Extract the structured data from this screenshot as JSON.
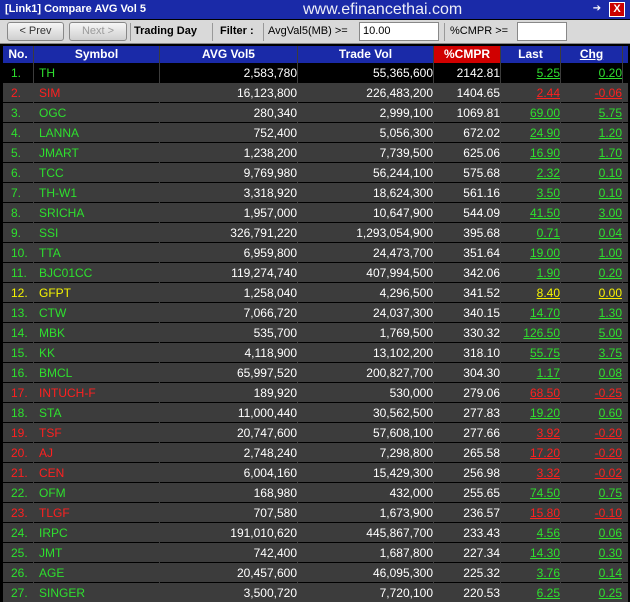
{
  "window": {
    "title": "[Link1] Compare AVG Vol 5",
    "watermark": "www.efinancethai.com",
    "pin_glyph": "➔",
    "close_glyph": "X"
  },
  "toolbar": {
    "prev_label": "< Prev",
    "next_label": "Next >",
    "trading_day_label": "Trading Day",
    "filter_label": "Filter :",
    "avg_filter_label": "AvgVal5(MB) >=",
    "avg_filter_value": "10.00",
    "cmpr_filter_label": "%CMPR >=",
    "cmpr_filter_value": ""
  },
  "columns": {
    "no": "No.",
    "symbol": "Symbol",
    "avg_vol5": "AVG Vol5",
    "trade_vol": "Trade Vol",
    "cmpr": "%CMPR",
    "last": "Last",
    "chg": "Chg"
  },
  "colors": {
    "up": "#2ee02e",
    "down": "#ff2020",
    "unchanged": "#f5f500",
    "header": "#1a2aa8",
    "active_sort": "#d00000"
  },
  "rows": [
    {
      "no": "1.",
      "symbol": "TH",
      "avg": "2,583,780",
      "trade": "55,365,600",
      "cmpr": "2142.81",
      "last": "5.25",
      "chg": "0.20",
      "dir": "up"
    },
    {
      "no": "2.",
      "symbol": "SIM",
      "avg": "16,123,800",
      "trade": "226,483,200",
      "cmpr": "1404.65",
      "last": "2.44",
      "chg": "-0.06",
      "dir": "down"
    },
    {
      "no": "3.",
      "symbol": "OGC",
      "avg": "280,340",
      "trade": "2,999,100",
      "cmpr": "1069.81",
      "last": "69.00",
      "chg": "5.75",
      "dir": "up"
    },
    {
      "no": "4.",
      "symbol": "LANNA",
      "avg": "752,400",
      "trade": "5,056,300",
      "cmpr": "672.02",
      "last": "24.90",
      "chg": "1.20",
      "dir": "up"
    },
    {
      "no": "5.",
      "symbol": "JMART",
      "avg": "1,238,200",
      "trade": "7,739,500",
      "cmpr": "625.06",
      "last": "16.90",
      "chg": "1.70",
      "dir": "up"
    },
    {
      "no": "6.",
      "symbol": "TCC",
      "avg": "9,769,980",
      "trade": "56,244,100",
      "cmpr": "575.68",
      "last": "2.32",
      "chg": "0.10",
      "dir": "up"
    },
    {
      "no": "7.",
      "symbol": "TH-W1",
      "avg": "3,318,920",
      "trade": "18,624,300",
      "cmpr": "561.16",
      "last": "3.50",
      "chg": "0.10",
      "dir": "up"
    },
    {
      "no": "8.",
      "symbol": "SRICHA",
      "avg": "1,957,000",
      "trade": "10,647,900",
      "cmpr": "544.09",
      "last": "41.50",
      "chg": "3.00",
      "dir": "up"
    },
    {
      "no": "9.",
      "symbol": "SSI",
      "avg": "326,791,220",
      "trade": "1,293,054,900",
      "cmpr": "395.68",
      "last": "0.71",
      "chg": "0.04",
      "dir": "up"
    },
    {
      "no": "10.",
      "symbol": "TTA",
      "avg": "6,959,800",
      "trade": "24,473,700",
      "cmpr": "351.64",
      "last": "19.00",
      "chg": "1.00",
      "dir": "up"
    },
    {
      "no": "11.",
      "symbol": "BJC01CC",
      "avg": "119,274,740",
      "trade": "407,994,500",
      "cmpr": "342.06",
      "last": "1.90",
      "chg": "0.20",
      "dir": "up"
    },
    {
      "no": "12.",
      "symbol": "GFPT",
      "avg": "1,258,040",
      "trade": "4,296,500",
      "cmpr": "341.52",
      "last": "8.40",
      "chg": "0.00",
      "dir": "unchanged"
    },
    {
      "no": "13.",
      "symbol": "CTW",
      "avg": "7,066,720",
      "trade": "24,037,300",
      "cmpr": "340.15",
      "last": "14.70",
      "chg": "1.30",
      "dir": "up"
    },
    {
      "no": "14.",
      "symbol": "MBK",
      "avg": "535,700",
      "trade": "1,769,500",
      "cmpr": "330.32",
      "last": "126.50",
      "chg": "5.00",
      "dir": "up"
    },
    {
      "no": "15.",
      "symbol": "KK",
      "avg": "4,118,900",
      "trade": "13,102,200",
      "cmpr": "318.10",
      "last": "55.75",
      "chg": "3.75",
      "dir": "up"
    },
    {
      "no": "16.",
      "symbol": "BMCL",
      "avg": "65,997,520",
      "trade": "200,827,700",
      "cmpr": "304.30",
      "last": "1.17",
      "chg": "0.08",
      "dir": "up"
    },
    {
      "no": "17.",
      "symbol": "INTUCH-F",
      "avg": "189,920",
      "trade": "530,000",
      "cmpr": "279.06",
      "last": "68.50",
      "chg": "-0.25",
      "dir": "down"
    },
    {
      "no": "18.",
      "symbol": "STA",
      "avg": "11,000,440",
      "trade": "30,562,500",
      "cmpr": "277.83",
      "last": "19.20",
      "chg": "0.60",
      "dir": "up"
    },
    {
      "no": "19.",
      "symbol": "TSF",
      "avg": "20,747,600",
      "trade": "57,608,100",
      "cmpr": "277.66",
      "last": "3.92",
      "chg": "-0.20",
      "dir": "down"
    },
    {
      "no": "20.",
      "symbol": "AJ",
      "avg": "2,748,240",
      "trade": "7,298,800",
      "cmpr": "265.58",
      "last": "17.20",
      "chg": "-0.20",
      "dir": "down"
    },
    {
      "no": "21.",
      "symbol": "CEN",
      "avg": "6,004,160",
      "trade": "15,429,300",
      "cmpr": "256.98",
      "last": "3.32",
      "chg": "-0.02",
      "dir": "down"
    },
    {
      "no": "22.",
      "symbol": "OFM",
      "avg": "168,980",
      "trade": "432,000",
      "cmpr": "255.65",
      "last": "74.50",
      "chg": "0.75",
      "dir": "up"
    },
    {
      "no": "23.",
      "symbol": "TLGF",
      "avg": "707,580",
      "trade": "1,673,900",
      "cmpr": "236.57",
      "last": "15.80",
      "chg": "-0.10",
      "dir": "down"
    },
    {
      "no": "24.",
      "symbol": "IRPC",
      "avg": "191,010,620",
      "trade": "445,867,700",
      "cmpr": "233.43",
      "last": "4.56",
      "chg": "0.06",
      "dir": "up"
    },
    {
      "no": "25.",
      "symbol": "JMT",
      "avg": "742,400",
      "trade": "1,687,800",
      "cmpr": "227.34",
      "last": "14.30",
      "chg": "0.30",
      "dir": "up"
    },
    {
      "no": "26.",
      "symbol": "AGE",
      "avg": "20,457,600",
      "trade": "46,095,300",
      "cmpr": "225.32",
      "last": "3.76",
      "chg": "0.14",
      "dir": "up"
    },
    {
      "no": "27.",
      "symbol": "SINGER",
      "avg": "3,500,720",
      "trade": "7,720,100",
      "cmpr": "220.53",
      "last": "6.25",
      "chg": "0.25",
      "dir": "up"
    }
  ]
}
